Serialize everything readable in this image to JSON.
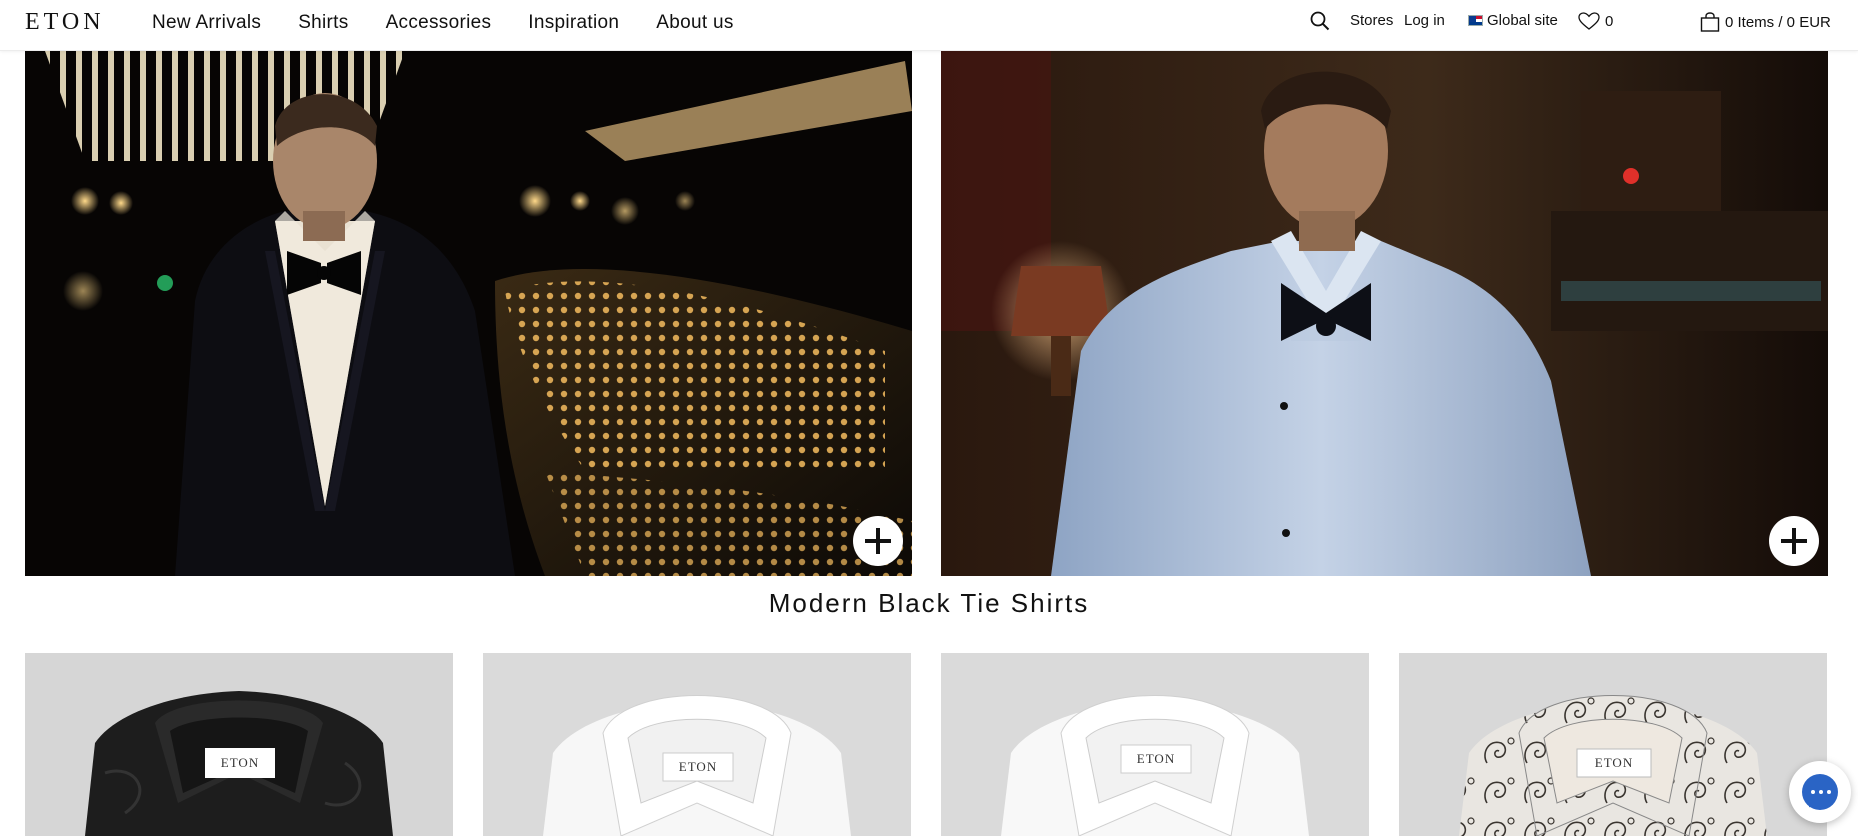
{
  "header": {
    "logo": "ETON",
    "nav": [
      {
        "label": "New Arrivals"
      },
      {
        "label": "Shirts"
      },
      {
        "label": "Accessories"
      },
      {
        "label": "Inspiration"
      },
      {
        "label": "About us"
      }
    ],
    "search_icon": "search-icon",
    "stores": "Stores",
    "login": "Log in",
    "global_site": "Global site",
    "wishlist_count": "0",
    "cart": "0 Items / 0 EUR"
  },
  "section": {
    "title": "Modern Black Tie Shirts"
  },
  "products": [
    {
      "brand_label": "ETON",
      "color": "black"
    },
    {
      "brand_label": "ETON",
      "color": "white"
    },
    {
      "brand_label": "ETON",
      "color": "white"
    },
    {
      "brand_label": "ETON",
      "color": "paisley"
    }
  ],
  "colors": {
    "accent_chat": "#2a64c5",
    "text": "#111111"
  }
}
